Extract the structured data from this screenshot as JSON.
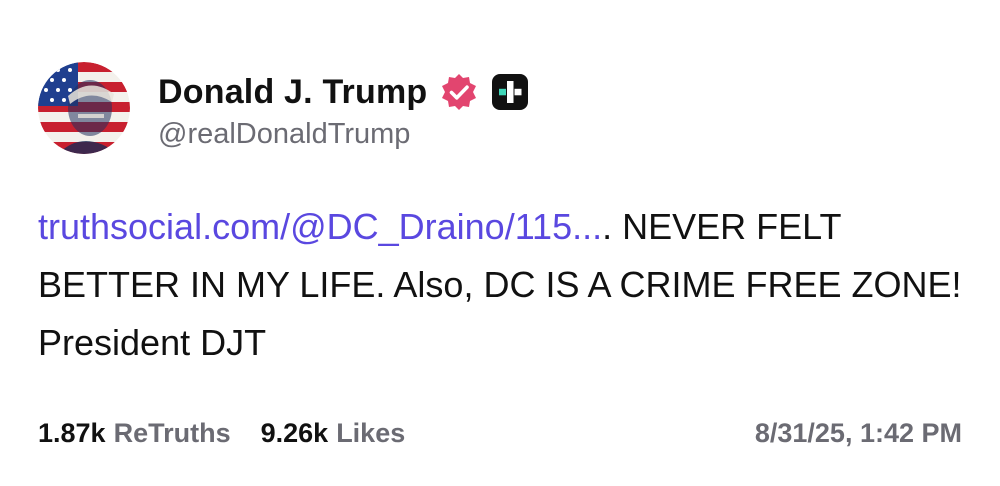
{
  "author": {
    "display_name": "Donald J. Trump",
    "handle": "@realDonaldTrump",
    "avatar_icon": "flag-portrait-avatar",
    "verified_icon": "verified-badge-icon",
    "subscriber_icon": "truth-plus-icon"
  },
  "post": {
    "link_text": "truthsocial.com/@DC_Draino/115...",
    "body_text": ". NEVER FELT BETTER IN MY LIFE. Also, DC IS A CRIME FREE ZONE! President DJT"
  },
  "stats": {
    "retruths_count": "1.87k",
    "retruths_label": "ReTruths",
    "likes_count": "9.26k",
    "likes_label": "Likes"
  },
  "timestamp": "8/31/25, 1:42 PM",
  "colors": {
    "link": "#5a48e0",
    "verified_badge": "#e2456f",
    "muted_text": "#6b6b73"
  }
}
